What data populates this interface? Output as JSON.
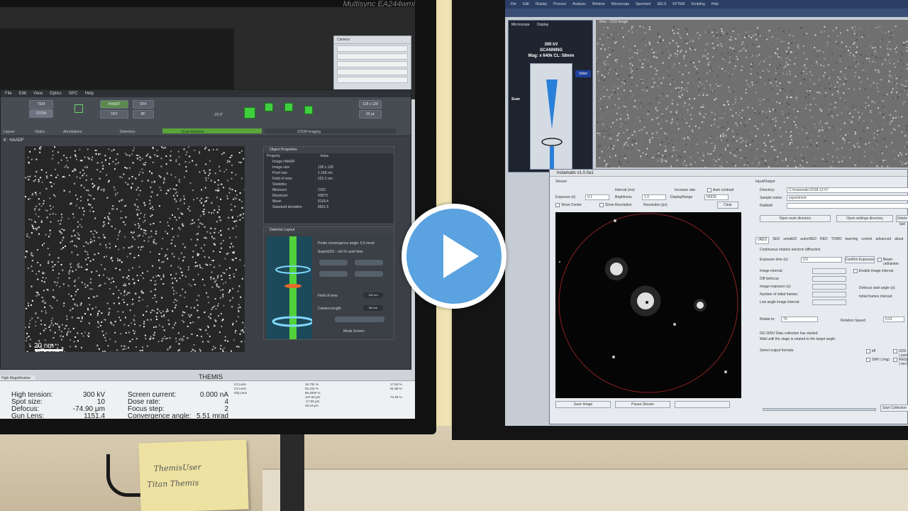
{
  "left_monitor": {
    "brand": "Multisync EA244wmi",
    "app_menu": [
      "File",
      "Edit",
      "View",
      "Optics",
      "DPC",
      "Help"
    ],
    "ribbon": {
      "mode_buttons": [
        "TEM",
        "STEM"
      ],
      "detectors": [
        "HAADF",
        "DF4",
        "DF2",
        "BF"
      ],
      "defocus_value": "-20.0°",
      "groups": [
        "Layout",
        "Optics",
        "Annotations",
        "Detectors",
        "Scan Rotation",
        "STEM Imaging"
      ],
      "frame_size": "128 x 128",
      "dwell": "20 μs"
    },
    "viewer_tab": "8 : HAADF",
    "scale_label": "20 nm",
    "object_properties": {
      "title": "Object Properties",
      "col_property": "Property",
      "col_value": "Value",
      "rows": [
        {
          "k": "Image HAADF",
          "v": ""
        },
        {
          "k": "Image size",
          "v": "128 x 128"
        },
        {
          "k": "Pixel size",
          "v": "1.189 nm"
        },
        {
          "k": "Field of view",
          "v": "152.2 nm"
        },
        {
          "k": "Statistics",
          "v": ""
        },
        {
          "k": "Minimum",
          "v": "2152"
        },
        {
          "k": "Maximum",
          "v": "43879"
        },
        {
          "k": "Mean",
          "v": "8118.4"
        },
        {
          "k": "Standard deviation",
          "v": "8501.5"
        }
      ]
    },
    "detector_layout": {
      "title": "Detector Layout",
      "probe_angle": "Probe convergence angle: 5.5 mrad",
      "super_eds": "SuperEDS - n/a    % used time",
      "fov_label": "Field of view",
      "fov_value": "152 nm",
      "camera_length_label": "Camera length",
      "camera_length_value": "58 mm",
      "mode_scan": "Mode Screen"
    },
    "status_title": "THEMIS",
    "status_tab": "High Magnification",
    "status_rows": [
      {
        "label": "High tension:",
        "value": "300 kV",
        "label2": "Screen current:",
        "value2": "0.000 nA"
      },
      {
        "label": "Spot size:",
        "value": "10",
        "label2": "Dose rate:",
        "value2": "4"
      },
      {
        "label": "Defocus:",
        "value": "-74.90 μm",
        "label2": "Focus step:",
        "value2": "2"
      },
      {
        "label": "Gun Lens:",
        "value": "1151.4",
        "label2": "Convergence angle:",
        "value2": "5.51 mrad"
      }
    ],
    "lens_small": [
      "C2 Lens",
      "C3 Lens",
      "Obj Lens"
    ],
    "lens_values": [
      "18.731 %",
      "53.102 %",
      "86.2000 %",
      "147.83 μm",
      "-17.00 μm",
      "15.24 μm"
    ],
    "right_values": [
      "17.53 %",
      "81.88 %",
      "72.46 %"
    ],
    "sticky_note": [
      "ThemisUser",
      "Titan Themis"
    ]
  },
  "right_monitor": {
    "menu": [
      "File",
      "Edit",
      "Display",
      "Process",
      "Analysis",
      "Window",
      "Microscope",
      "Spectrum",
      "EELS",
      "EFTEM",
      "Scripting",
      "Help"
    ],
    "microscope_panel": {
      "tabs": [
        "Microscope",
        "Display"
      ],
      "kv": "300 kV",
      "mode": "SCANNING",
      "mag": "Mag: x 640k   CL: 58mm",
      "valve": "Valve",
      "scan": "Scan"
    },
    "ccd_title": "View - CCD Image",
    "instamatic": {
      "title": "instamatic v1.0.0a1",
      "stream_label": "Stream",
      "exposure_label": "Exposure (s)",
      "exposure_value": "0.1",
      "brightness_label": "Brightness",
      "brightness_value": "1.0",
      "display_range_label": "DisplayRange",
      "display_range_value": "65535",
      "interval_label": "Interval (ms)",
      "auto_contrast": "Auto contrast",
      "increase_label": "Increase rate",
      "resolution_label": "Resolution (px)",
      "show_center": "Show Center",
      "show_resolution": "Show Resolution",
      "clear": "Clear",
      "io_label": "Input/Output",
      "directory_label": "Directory:",
      "directory_value": "C:\\instamatic\\2018-12-07",
      "sample_label": "Sample name:",
      "sample_value": "experiment",
      "flatfield_label": "Flatfield:",
      "open_work_dir": "Open work directory",
      "open_settings_dir": "Open settings directory",
      "delete_last": "Delete last",
      "tabs": [
        "cRED",
        "SED",
        "serialED",
        "autocRED",
        "RED",
        "TOMO",
        "learning",
        "control",
        "advanced",
        "about"
      ],
      "section": "Continuous rotation electron diffraction",
      "exposure_time_label": "Exposure time (s):",
      "exposure_time_value": "0.5",
      "confirm_exposure": "Confirm Exposure",
      "beam_unblanker": "Beam unblanker",
      "toggle_screen": "Toggle screen",
      "image_interval_label": "Image interval:",
      "diff_defocus_label": "Diff defocus:",
      "image_exposure_label": "Image exposure (s):",
      "initial_frames_label": "Number of initial frames:",
      "low_angle_label": "Low angle image interval:",
      "enable_image_interval": "Enable image interval",
      "defocus_start_label": "Defocus start angle (s):",
      "initial_frames_interval": "Initial frames interval:",
      "rotate_to_label": "Rotate to:",
      "rotate_to_value": "70",
      "rotation_speed_label": "Rotation Speed:",
      "rotation_speed_value": "0.01",
      "status_line1": "FEI 300U Data collection has started.",
      "status_line2": "Wait until the stage is rotated to the target angle.",
      "output_formats_label": "Select output formats:",
      "formats": [
        "tiff",
        "SMV (.img)",
        "XDS (.ssm)",
        "REDp (.mrc)"
      ],
      "save_image": "Save Image",
      "pause_stream": "Pause Stream",
      "start_collection": "Start Collection"
    }
  },
  "play_button_icon": "play-icon",
  "colors": {
    "play_blue": "#5aa2e0",
    "stem_green": "#52d23a",
    "beam_blue": "#2a7fd8"
  }
}
